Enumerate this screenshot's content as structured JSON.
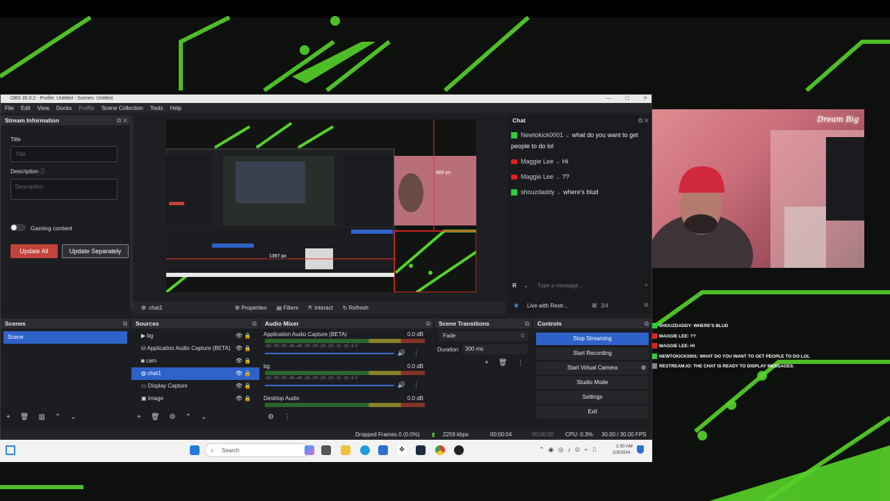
{
  "window": {
    "title": "OBS 30.0.2 - Profile: Untitled - Scenes: Untitled"
  },
  "menu": [
    "File",
    "Edit",
    "View",
    "Docks",
    "Profile",
    "Scene Collection",
    "Tools",
    "Help"
  ],
  "stream_info": {
    "header": "Stream Information",
    "title_label": "Title",
    "title_placeholder": "Title",
    "desc_label": "Description",
    "desc_placeholder": "Description",
    "gaming_label": "Gaming content",
    "update_all": "Update All",
    "update_separately": "Update Separately"
  },
  "preview": {
    "width_label": "688 px",
    "height_label": "1397 px"
  },
  "source_bar": {
    "source": "chat1",
    "properties": "Properties",
    "filters": "Filters",
    "interact": "Interact",
    "refresh": "Refresh"
  },
  "chat": {
    "header": "Chat",
    "messages": [
      {
        "user": "Newtokick0001",
        "text": "what do you want to get people to do lol",
        "platform": "kick"
      },
      {
        "user": "Maggie Lee",
        "text": "Hi",
        "platform": "youtube"
      },
      {
        "user": "Maggie Lee",
        "text": "??",
        "platform": "youtube"
      },
      {
        "user": "shouzdaddy",
        "text": "where's blud",
        "platform": "kick"
      }
    ],
    "input_placeholder": "Type a message...",
    "live_with": "Live with Restr...",
    "viewers": "3/4"
  },
  "scenes": {
    "header": "Scenes",
    "items": [
      "Scene"
    ]
  },
  "sources": {
    "header": "Sources",
    "items": [
      "bg",
      "Application Audio Capture (BETA)",
      "cam",
      "chat1",
      "Display Capture",
      "Image"
    ],
    "selected": "chat1"
  },
  "mixer": {
    "header": "Audio Mixer",
    "channels": [
      {
        "name": "Application Audio Capture (BETA)",
        "db": "0.0 dB"
      },
      {
        "name": "bg",
        "db": "0.0 dB"
      },
      {
        "name": "Desktop Audio",
        "db": "0.0 dB"
      }
    ],
    "ticks": "-60 -55 -50 -45 -40 -35 -30 -25 -20 -15 -10 -5 0"
  },
  "transitions": {
    "header": "Scene Transitions",
    "type": "Fade",
    "duration_label": "Duration",
    "duration": "300 ms"
  },
  "controls": {
    "header": "Controls",
    "buttons": [
      "Stop Streaming",
      "Start Recording",
      "Start Virtual Camera",
      "Studio Mode",
      "Settings",
      "Exit"
    ]
  },
  "status": {
    "dropped": "Dropped Frames 0 (0.0%)",
    "kbps": "2259 kbps",
    "stream_time": "00:00:04",
    "rec_time": "00:00:00",
    "cpu": "CPU: 0.3%",
    "fps": "30.00 / 30.00 FPS"
  },
  "taskbar": {
    "search": "Search",
    "time": "1:30 AM",
    "date": "2/3/2024"
  },
  "overlay_chat": [
    "SHOUZDADDY: WHERE'S BLUD",
    "MAGGIE LEE: ??",
    "MAGGIE LEE: HI",
    "NEWTOKICK0001: WHAT DO YOU WANT TO GET PEOPLE TO DO LOL",
    "RESTREAM.IO: THE CHAT IS READY TO DISPLAY MESSAGES."
  ],
  "webcam": {
    "sign": "Dream Big"
  },
  "colors": {
    "accent": "#2f62c9",
    "kick": "#2ecc40",
    "youtube": "#e02020",
    "update_all": "#c2433a",
    "bg_green": "#57d62a"
  }
}
